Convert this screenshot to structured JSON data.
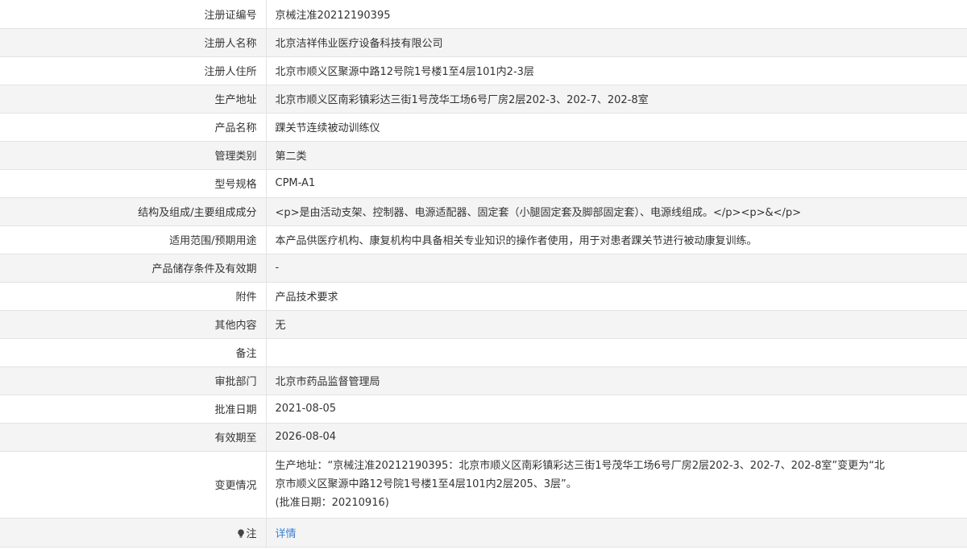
{
  "rows": [
    {
      "label": "注册证编号",
      "value": "京械注准20212190395"
    },
    {
      "label": "注册人名称",
      "value": "北京洁祥伟业医疗设备科技有限公司"
    },
    {
      "label": "注册人住所",
      "value": "北京市顺义区聚源中路12号院1号楼1至4层101内2-3层"
    },
    {
      "label": "生产地址",
      "value": "北京市顺义区南彩镇彩达三街1号茂华工场6号厂房2层202-3、202-7、202-8室"
    },
    {
      "label": "产品名称",
      "value": "踝关节连续被动训练仪"
    },
    {
      "label": "管理类别",
      "value": "第二类"
    },
    {
      "label": "型号规格",
      "value": "CPM-A1"
    },
    {
      "label": "结构及组成/主要组成成分",
      "value": "<p>是由活动支架、控制器、电源适配器、固定套（小腿固定套及脚部固定套）、电源线组成。</p><p>&</p>"
    },
    {
      "label": "适用范围/预期用途",
      "value": "本产品供医疗机构、康复机构中具备相关专业知识的操作者使用，用于对患者踝关节进行被动康复训练。"
    },
    {
      "label": "产品储存条件及有效期",
      "value": "-"
    },
    {
      "label": "附件",
      "value": "产品技术要求"
    },
    {
      "label": "其他内容",
      "value": "无"
    },
    {
      "label": "备注",
      "value": ""
    },
    {
      "label": "审批部门",
      "value": "北京市药品监督管理局"
    },
    {
      "label": "批准日期",
      "value": "2021-08-05"
    },
    {
      "label": "有效期至",
      "value": "2026-08-04"
    }
  ],
  "change": {
    "label": "变更情况",
    "line1": "生产地址：“京械注准20212190395：北京市顺义区南彩镇彩达三街1号茂华工场6号厂房2层202-3、202-7、202-8室”变更为“北",
    "line2": "京市顺义区聚源中路12号院1号楼1至4层101内2层205、3层”。",
    "line3": "(批准日期：20210916)"
  },
  "note": {
    "label": "注",
    "link": "详情",
    "icon": "lightbulb-icon",
    "link_color": "#3b7fd4"
  }
}
